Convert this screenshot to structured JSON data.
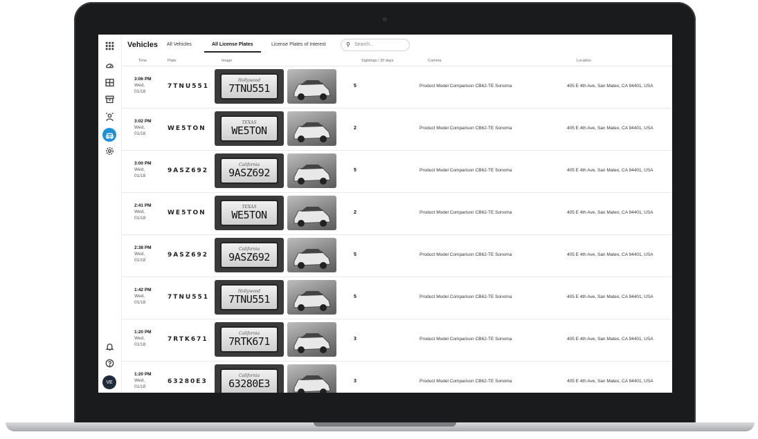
{
  "app": {
    "title": "Vehicles",
    "tabs": [
      {
        "label": "All Vehicles",
        "active": false
      },
      {
        "label": "All License Plates",
        "active": true
      },
      {
        "label": "License Plates of Interest",
        "active": false
      }
    ],
    "search_placeholder": "Search...",
    "avatar_initials": "VE"
  },
  "sidebar": {
    "icons": [
      "grid-icon",
      "speedometer-icon",
      "floorplan-icon",
      "archive-icon",
      "people-icon",
      "vehicle-icon",
      "settings-icon",
      "bell-icon",
      "help-icon"
    ],
    "active_icon": "vehicle-icon",
    "accent_color": "#1f8fd6"
  },
  "columns": [
    "Time",
    "Plate",
    "Image",
    "Sightings / 30 days",
    "Camera",
    "Location"
  ],
  "rows": [
    {
      "time": "3:06 PM",
      "day": "Wed,",
      "date": "01/18",
      "plate": "7TNU551",
      "plate_state": "Hollywood",
      "sightings": "5",
      "camera": "Product Model Comparison CB62-TE Sonoma",
      "location": "405 E 4th Ave, San Mateo, CA 94401, USA"
    },
    {
      "time": "3:02 PM",
      "day": "Wed,",
      "date": "01/18",
      "plate": "WE5TON",
      "plate_state": "TEXAS",
      "sightings": "2",
      "camera": "Product Model Comparison CB62-TE Sonoma",
      "location": "405 E 4th Ave, San Mateo, CA 94401, USA"
    },
    {
      "time": "3:00 PM",
      "day": "Wed,",
      "date": "01/18",
      "plate": "9ASZ692",
      "plate_state": "California",
      "sightings": "5",
      "camera": "Product Model Comparison CB62-TE Sonoma",
      "location": "405 E 4th Ave, San Mateo, CA 94401, USA"
    },
    {
      "time": "2:41 PM",
      "day": "Wed,",
      "date": "01/18",
      "plate": "WE5TON",
      "plate_state": "TEXAS",
      "sightings": "2",
      "camera": "Product Model Comparison CB62-TE Sonoma",
      "location": "405 E 4th Ave, San Mateo, CA 94401, USA"
    },
    {
      "time": "2:38 PM",
      "day": "Wed,",
      "date": "01/18",
      "plate": "9ASZ692",
      "plate_state": "California",
      "sightings": "5",
      "camera": "Product Model Comparison CB62-TE Sonoma",
      "location": "405 E 4th Ave, San Mateo, CA 94401, USA"
    },
    {
      "time": "1:42 PM",
      "day": "Wed,",
      "date": "01/18",
      "plate": "7TNU551",
      "plate_state": "Hollywood",
      "sightings": "5",
      "camera": "Product Model Comparison CB62-TE Sonoma",
      "location": "405 E 4th Ave, San Mateo, CA 94401, USA"
    },
    {
      "time": "1:20 PM",
      "day": "Wed,",
      "date": "01/18",
      "plate": "7RTK671",
      "plate_state": "California",
      "sightings": "3",
      "camera": "Product Model Comparison CB62-TE Sonoma",
      "location": "405 E 4th Ave, San Mateo, CA 94401, USA"
    },
    {
      "time": "1:20 PM",
      "day": "Wed,",
      "date": "01/18",
      "plate": "63280E3",
      "plate_state": "California",
      "sightings": "3",
      "camera": "Product Model Comparison CB62-TE Sonoma",
      "location": "405 E 4th Ave, San Mateo, CA 94401, USA"
    }
  ]
}
